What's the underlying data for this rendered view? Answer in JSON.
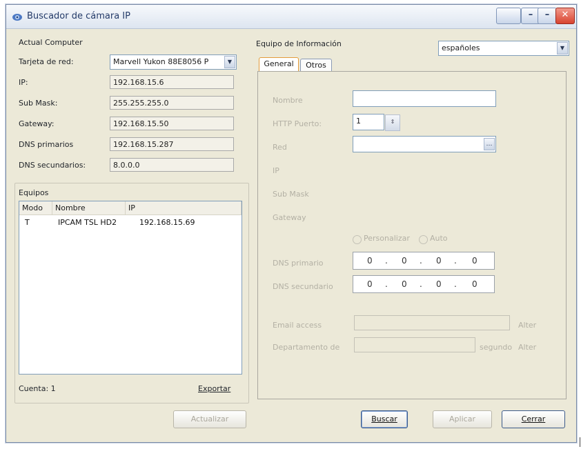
{
  "window": {
    "title": "Buscador de cámara IP",
    "controls": {
      "minimize": "–",
      "maximize": "–",
      "close": "✕"
    }
  },
  "computer": {
    "section_title": "Actual Computer",
    "fields": [
      {
        "label": "Tarjeta de red:",
        "value": "Marvell Yukon 88E8056 P"
      },
      {
        "label": "IP:",
        "value": "192.168.15.6"
      },
      {
        "label": "Sub Mask:",
        "value": "255.255.255.0"
      },
      {
        "label": "Gateway:",
        "value": "192.168.15.50"
      },
      {
        "label": "DNS primarios",
        "value": "192.168.15.287"
      },
      {
        "label": "DNS secundarios:",
        "value": "8.0.0.0"
      }
    ]
  },
  "devices": {
    "section_title": "Equipos",
    "columns": [
      "Modo",
      "Nombre",
      "IP"
    ],
    "rows": [
      {
        "mode": "T",
        "name": "IPCAM TSL HD2",
        "ip": "192.168.15.69"
      }
    ],
    "count_label": "Cuenta: 1",
    "export_label": "Exportar"
  },
  "info": {
    "section_title": "Equipo de Información",
    "language": "españoles",
    "tabs": [
      "General",
      "Otros"
    ],
    "fields": {
      "name_label": "Nombre",
      "http_port_label": "HTTP Puerto:",
      "http_port_value": "1",
      "network_label": "Red",
      "ip_label": "IP",
      "submask_label": "Sub Mask",
      "gateway_label": "Gateway",
      "mode_options": [
        "Personalizar",
        "Auto"
      ],
      "dns_primary_label": "DNS primario",
      "dns_secondary_label": "DNS secundario",
      "dns_primary_octets": [
        "0",
        "0",
        "0",
        "0"
      ],
      "dns_secondary_octets": [
        "0",
        "0",
        "0",
        "0"
      ],
      "email_label": "Email access",
      "email_suffix": "Alter",
      "storage_label": "Departamento de",
      "storage_suffix_1": "segundo",
      "storage_suffix_2": "Alter"
    }
  },
  "footer": {
    "update": "Actualizar",
    "search": "Buscar",
    "apply": "Aplicar",
    "close": "Cerrar"
  }
}
